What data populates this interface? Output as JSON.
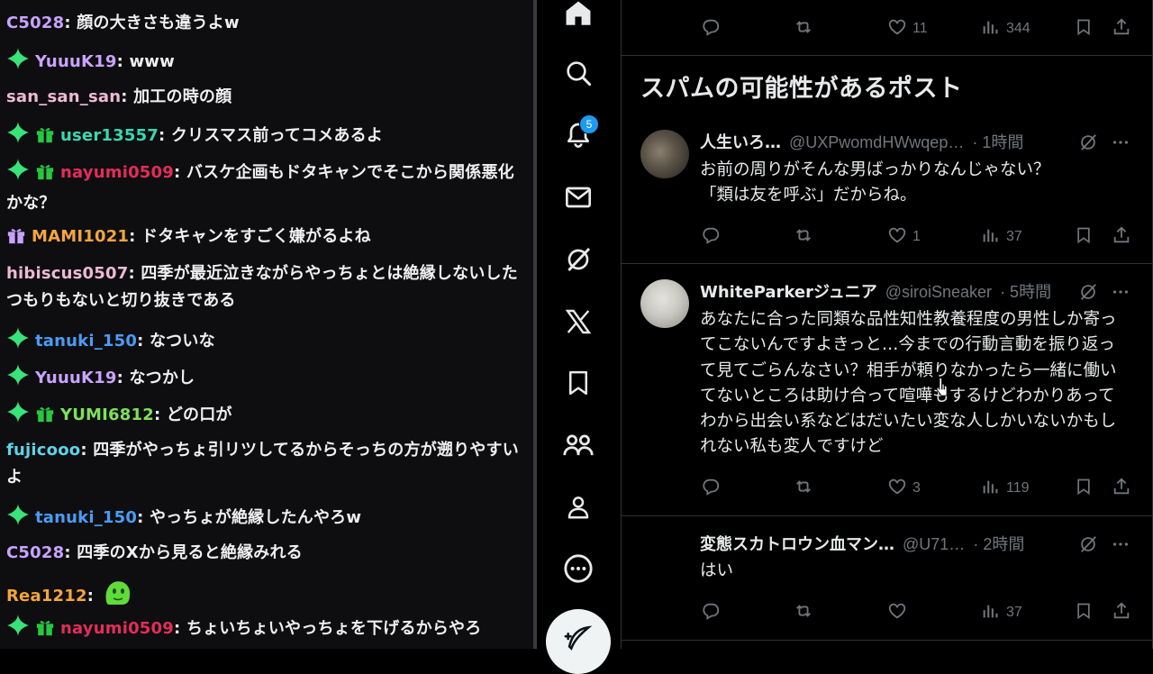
{
  "chat": {
    "messages": [
      {
        "user": "C5028",
        "color": "#c9a3ff",
        "text": "顔の大きさも違うよw",
        "badges": []
      },
      {
        "user": "YuuuK19",
        "color": "#c9a3ff",
        "text": "www",
        "badges": [
          "sparkle"
        ]
      },
      {
        "user": "san_san_san",
        "color": "#efb9d4",
        "text": "加工の時の顔",
        "badges": []
      },
      {
        "user": "user13557",
        "color": "#3ad7b0",
        "text": "クリスマス前ってコメあるよ",
        "badges": [
          "sparkle",
          "gift"
        ]
      },
      {
        "user": "nayumi0509",
        "color": "#e32d5b",
        "text": "バスケ企画もドタキャンでそこから関係悪化かな？",
        "badges": [
          "sparkle",
          "gift"
        ]
      },
      {
        "user": "MAMI1021",
        "color": "#f5a53b",
        "text": "ドタキャンをすごく嫌がるよね",
        "badges": [
          "gift-purple"
        ]
      },
      {
        "user": "hibiscus0507",
        "color": "#efb9d4",
        "text": "四季が最近泣きながらやっちょとは絶縁しないしたつもりもないと切り抜きである",
        "badges": []
      },
      {
        "user": "tanuki_150",
        "color": "#4a9cf5",
        "text": "なついな",
        "badges": [
          "sparkle"
        ]
      },
      {
        "user": "YuuuK19",
        "color": "#c9a3ff",
        "text": "なつかし",
        "badges": [
          "sparkle"
        ]
      },
      {
        "user": "YUMI6812",
        "color": "#7ee05a",
        "text": "どの口が",
        "badges": [
          "sparkle",
          "gift"
        ]
      },
      {
        "user": "fujicooo",
        "color": "#5fd2e8",
        "text": "四季がやっちょ引リツしてるからそっちの方が遡りやすいよ",
        "badges": []
      },
      {
        "user": "tanuki_150",
        "color": "#4a9cf5",
        "text": "やっちょが絶縁したんやろw",
        "badges": [
          "sparkle"
        ]
      },
      {
        "user": "C5028",
        "color": "#c9a3ff",
        "text": "四季のXから見ると絶縁みれる",
        "badges": []
      },
      {
        "user": "Rea1212",
        "color": "#f5a53b",
        "text": "",
        "badges": [],
        "emote": "green-blob"
      },
      {
        "user": "nayumi0509",
        "color": "#e32d5b",
        "text": "ちょいちょいやっちょを下げるからやろ",
        "badges": [
          "sparkle",
          "gift"
        ]
      }
    ]
  },
  "nav": {
    "items": [
      "home",
      "search",
      "notifications",
      "messages",
      "grok",
      "x-premium",
      "bookmarks",
      "communities",
      "profile",
      "more"
    ],
    "notification_count": "5"
  },
  "feed": {
    "top_actions": {
      "likes": "11",
      "views": "344"
    },
    "section_title": "スパムの可能性があるポスト",
    "posts": [
      {
        "name": "人生いろ…",
        "handle": "@UXPwomdHWwqep…",
        "time": "· 1時間",
        "body": "お前の周りがそんな男ばっかりなんじゃない？\n「類は友を呼ぶ」だからね。",
        "likes": "1",
        "views": "37"
      },
      {
        "name": "WhiteParkerジュニア",
        "handle": "@siroiSneaker",
        "time": "· 5時間",
        "body": "あなたに合った同類な品性知性教養程度の男性しか寄ってこないんですよきっと…今までの行動言動を振り返って見てごらんなさい？相手が頼りなかったら一緒に働いてないところは助け合って喧嘩もするけどわかりあってわから出会い系などはだいたい変な人しかいないかもしれない私も変人ですけど",
        "likes": "3",
        "views": "119"
      },
      {
        "name": "変態スカトロウン血マン…",
        "handle": "@U71…",
        "time": "· 2時間",
        "body": "はい",
        "likes": "",
        "views": "37"
      }
    ]
  }
}
